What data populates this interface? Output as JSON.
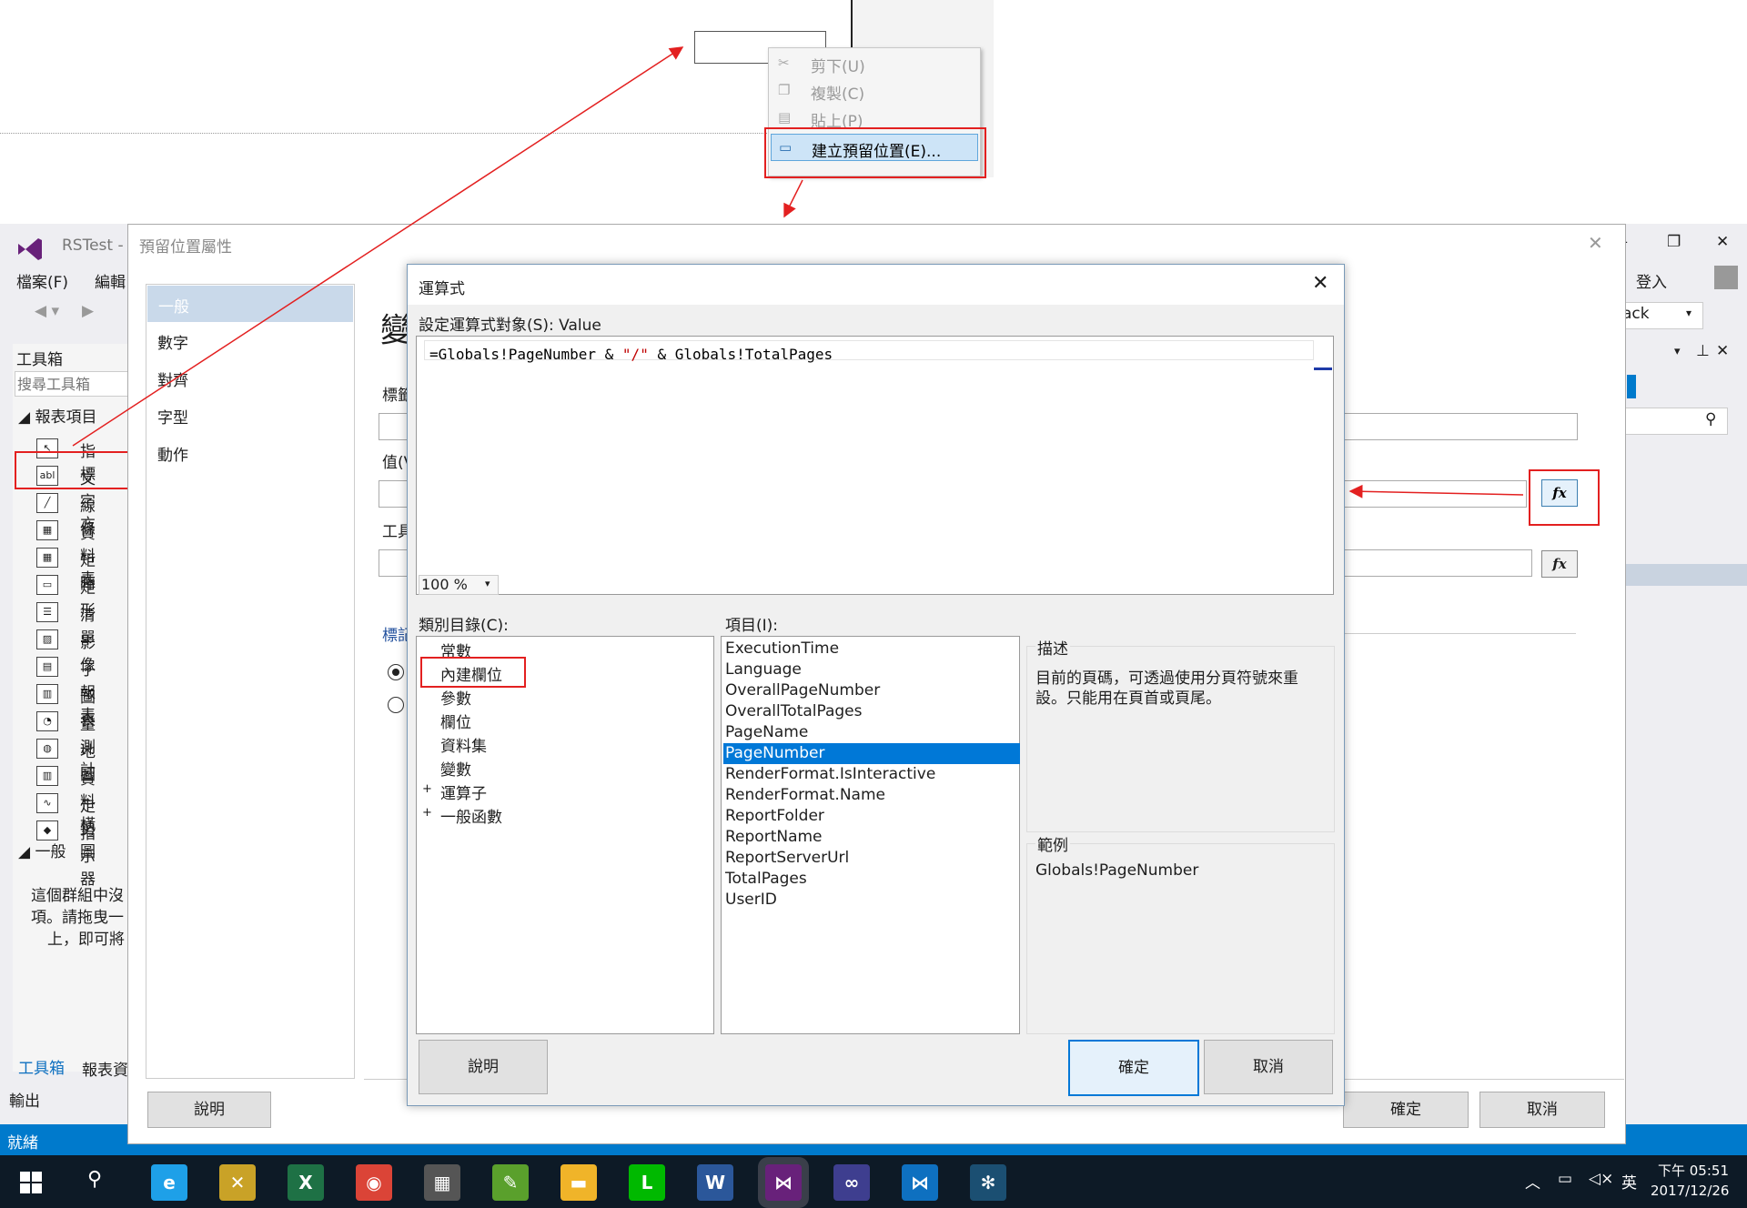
{
  "context_menu": {
    "items": [
      {
        "label": "剪下(U)",
        "icon": "scissors-icon",
        "enabled": false
      },
      {
        "label": "複製(C)",
        "icon": "copy-icon",
        "enabled": false
      },
      {
        "label": "貼上(P)",
        "icon": "paste-icon",
        "enabled": false
      },
      {
        "label": "建立預留位置(E)...",
        "icon": "placeholder-icon",
        "enabled": true
      }
    ]
  },
  "vs": {
    "title": "RSTest -",
    "menu": {
      "file": "檔案(F)",
      "edit": "編輯"
    },
    "signin": "登入",
    "combo_value": "ack",
    "status": "就緒",
    "output_label": "輸出",
    "window_buttons": {
      "minimize": "—",
      "restore": "❐",
      "close": "✕"
    }
  },
  "toolbox": {
    "title": "工具箱",
    "search_placeholder": "搜尋工具箱",
    "group_report": "報表項目",
    "items": [
      {
        "label": "指標",
        "icon": "pointer-icon"
      },
      {
        "label": "文字方",
        "icon": "textbox-icon"
      },
      {
        "label": "線條",
        "icon": "line-icon"
      },
      {
        "label": "資料表",
        "icon": "table-icon"
      },
      {
        "label": "矩陣",
        "icon": "matrix-icon"
      },
      {
        "label": "矩形",
        "icon": "rectangle-icon"
      },
      {
        "label": "清單",
        "icon": "list-icon"
      },
      {
        "label": "影像",
        "icon": "image-icon"
      },
      {
        "label": "子報表",
        "icon": "subreport-icon"
      },
      {
        "label": "圖表",
        "icon": "chart-icon"
      },
      {
        "label": "量測計",
        "icon": "gauge-icon"
      },
      {
        "label": "地圖",
        "icon": "map-icon"
      },
      {
        "label": "資料橫",
        "icon": "databar-icon"
      },
      {
        "label": "走勢圖",
        "icon": "sparkline-icon"
      },
      {
        "label": "指示器",
        "icon": "indicator-icon"
      }
    ],
    "group_general": "一般",
    "empty_text_1": "這個群組中沒",
    "empty_text_2": "項。請拖曳一",
    "empty_text_3": "上，即可將",
    "tab_toolbox": "工具箱",
    "tab_report": "報表資"
  },
  "prop_dialog": {
    "title": "預留位置屬性",
    "nav": [
      "一般",
      "數字",
      "對齊",
      "字型",
      "動作"
    ],
    "heading_partial": "變",
    "label_partial_1": "標籤",
    "label_partial_2": "值(V",
    "label_partial_3": "工具",
    "label_partial_4": "標記",
    "fx_label": "fx",
    "help": "說明",
    "ok": "確定",
    "cancel": "取消"
  },
  "expr_dialog": {
    "title": "運算式",
    "target_label": "設定運算式對象(S): Value",
    "expression": {
      "p1": "=Globals!PageNumber & ",
      "p2": "\"/\"",
      "p3": " & Globals!TotalPages"
    },
    "zoom": "100 %",
    "category_label": "類別目錄(C):",
    "categories": [
      {
        "label": "常數",
        "expander": ""
      },
      {
        "label": "內建欄位",
        "expander": ""
      },
      {
        "label": "參數",
        "expander": ""
      },
      {
        "label": "欄位",
        "expander": ""
      },
      {
        "label": "資料集",
        "expander": ""
      },
      {
        "label": "變數",
        "expander": ""
      },
      {
        "label": "運算子",
        "expander": "+"
      },
      {
        "label": "一般函數",
        "expander": "+"
      }
    ],
    "items_label": "項目(I):",
    "items": [
      "ExecutionTime",
      "Language",
      "OverallPageNumber",
      "OverallTotalPages",
      "PageName",
      "PageNumber",
      "RenderFormat.IsInteractive",
      "RenderFormat.Name",
      "ReportFolder",
      "ReportName",
      "ReportServerUrl",
      "TotalPages",
      "UserID"
    ],
    "selected_item": "PageNumber",
    "desc_label": "描述",
    "desc_line1": "目前的頁碼，可透過使用分頁符號來重",
    "desc_line2": "設。只能用在頁首或頁尾。",
    "example_label": "範例",
    "example": "Globals!PageNumber",
    "help": "說明",
    "ok": "確定",
    "cancel": "取消"
  },
  "taskbar": {
    "apps": [
      "ie-icon",
      "tools-icon",
      "excel-icon",
      "chrome-icon",
      "calculator-icon",
      "paint-icon",
      "explorer-icon",
      "line-app-icon",
      "word-icon",
      "visual-studio-icon",
      "infinity-icon",
      "vscode-icon",
      "tree-icon"
    ],
    "clock_time": "下午 05:51",
    "clock_date": "2017/12/26",
    "ime": "英"
  },
  "colors": {
    "accent": "#007acc",
    "selection": "#0078d7",
    "annotation": "#e32020",
    "vs_purple": "#68217a"
  }
}
